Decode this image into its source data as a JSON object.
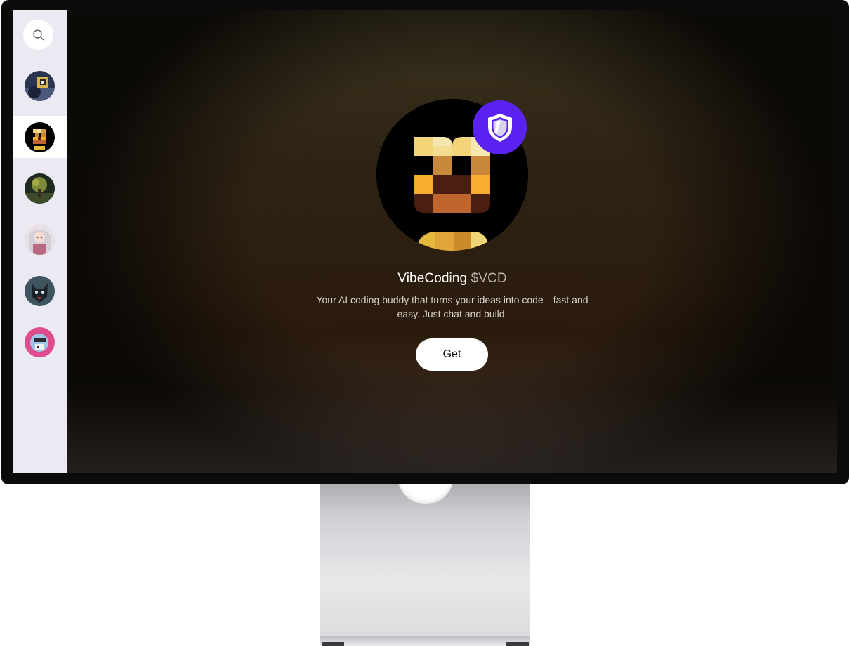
{
  "sidebar": {
    "search_icon": "search-icon",
    "items": [
      {
        "name": "avatar-1",
        "active": false
      },
      {
        "name": "avatar-vibecoding",
        "active": true
      },
      {
        "name": "avatar-tree",
        "active": false
      },
      {
        "name": "avatar-anime",
        "active": false
      },
      {
        "name": "avatar-wolf",
        "active": false
      },
      {
        "name": "avatar-pink",
        "active": false
      }
    ]
  },
  "token": {
    "name": "VibeCoding",
    "ticker": "$VCD",
    "description": "Your AI coding buddy that turns your ideas into code—fast and easy. Just chat and build.",
    "badge_icon": "shield-icon"
  },
  "actions": {
    "get_label": "Get"
  },
  "colors": {
    "badge": "#5a22f0",
    "background_dark": "#2a1a0c",
    "button": "#ffffff"
  }
}
